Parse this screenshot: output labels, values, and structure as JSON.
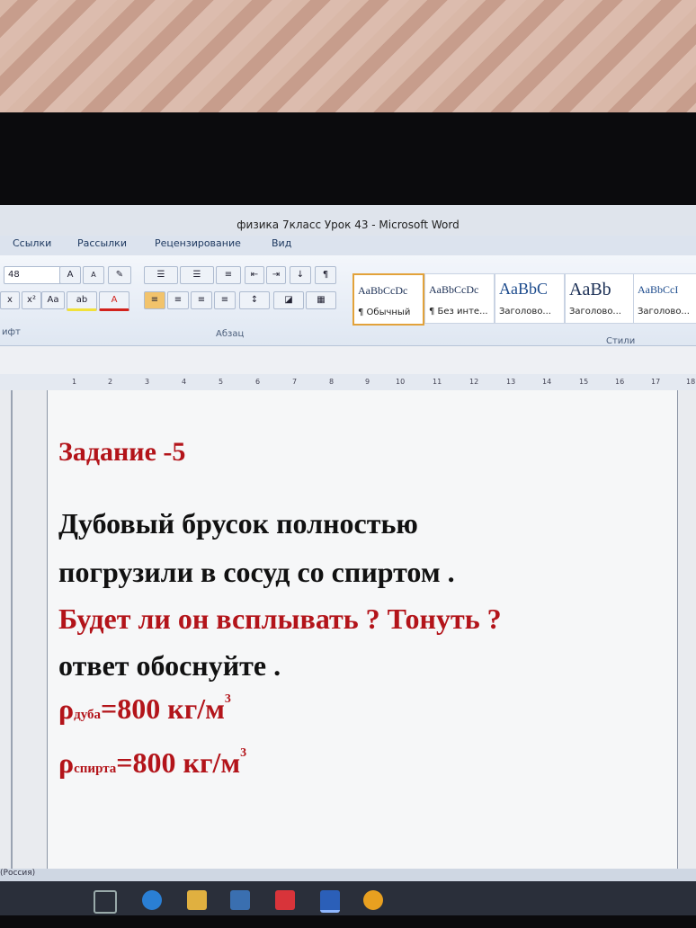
{
  "window": {
    "title": "физика 7класс Урок 43 - Microsoft Word"
  },
  "ribbon_tabs": [
    "Ссылки",
    "Рассылки",
    "Рецензирование",
    "Вид"
  ],
  "font_group": {
    "font_size": "48",
    "label": "ифт"
  },
  "paragraph_group": {
    "label": "Абзац"
  },
  "styles_group": {
    "label": "Стили",
    "items": [
      {
        "sample": "AaBbCcDc",
        "name": "¶ Обычный"
      },
      {
        "sample": "AaBbCcDc",
        "name": "¶ Без инте..."
      },
      {
        "sample": "AaBbC",
        "name": "Заголово..."
      },
      {
        "sample": "AaBb",
        "name": "Заголово..."
      },
      {
        "sample": "AaBbCcI",
        "name": "Заголово..."
      }
    ]
  },
  "ruler": {
    "marks": [
      "1",
      "2",
      "3",
      "4",
      "5",
      "6",
      "7",
      "8",
      "9",
      "10",
      "11",
      "12",
      "13",
      "14",
      "15",
      "16",
      "17",
      "18"
    ]
  },
  "document": {
    "heading": "Задание -5",
    "line1": "Дубовый брусок полностью",
    "line2": "погрузили в сосуд со спиртом .",
    "line3": "Будет ли он всплывать ? Тонуть ?",
    "line4": "ответ обоснуйте .",
    "rho1_symbol": "ρ",
    "rho1_sub": "дуба",
    "rho1_value": "=800 кг/м",
    "rho1_exp": "3",
    "rho2_symbol": "ρ",
    "rho2_sub": "спирта",
    "rho2_value": "=800 кг/м",
    "rho2_exp": "3"
  },
  "status": {
    "language": "(Россия)"
  },
  "colors": {
    "accent_red": "#b3141a",
    "text": "#111111",
    "style_selected": "#e2a23a"
  }
}
